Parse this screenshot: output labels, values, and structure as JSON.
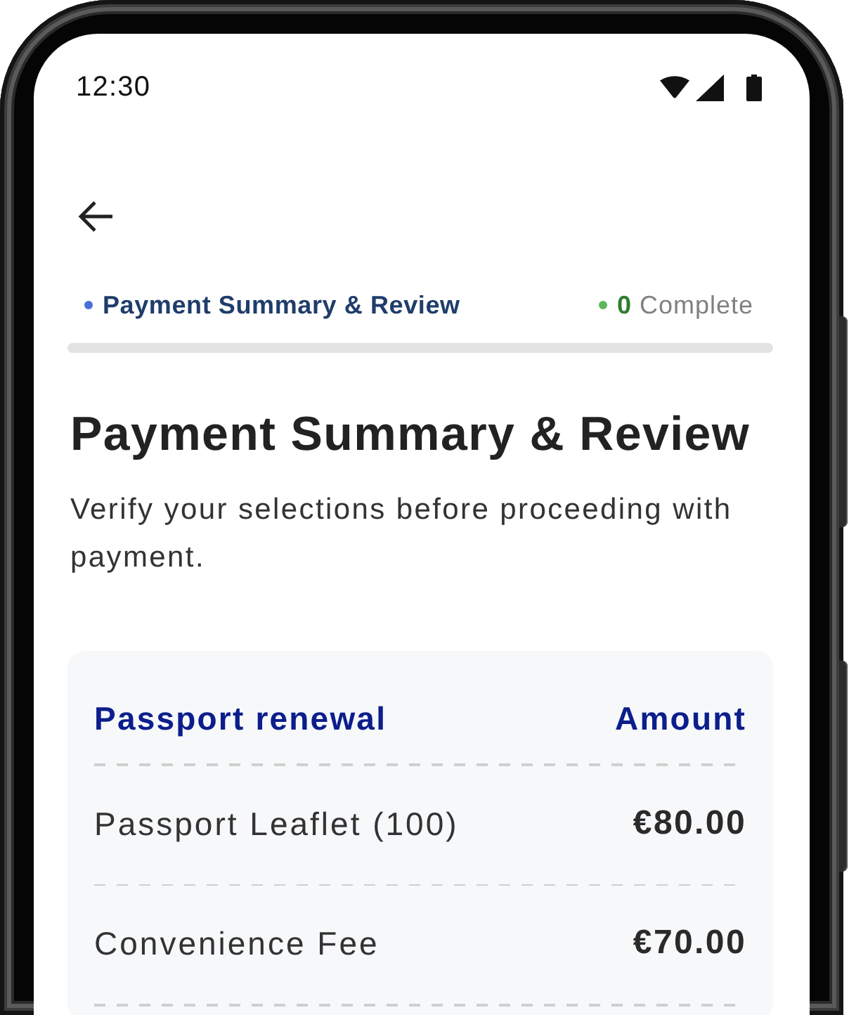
{
  "status_bar": {
    "time": "12:30"
  },
  "progress": {
    "step": "Payment Summary & Review",
    "count": "0",
    "count_label": "Complete"
  },
  "page": {
    "title": "Payment Summary & Review",
    "subtitle": "Verify your selections before proceeding with payment."
  },
  "summary_table": {
    "columns": [
      "Passport renewal",
      "Amount"
    ],
    "rows": [
      {
        "item": "Passport Leaflet (100)",
        "amount": "€80.00"
      },
      {
        "item": "Convenience Fee",
        "amount": "€70.00"
      }
    ]
  }
}
